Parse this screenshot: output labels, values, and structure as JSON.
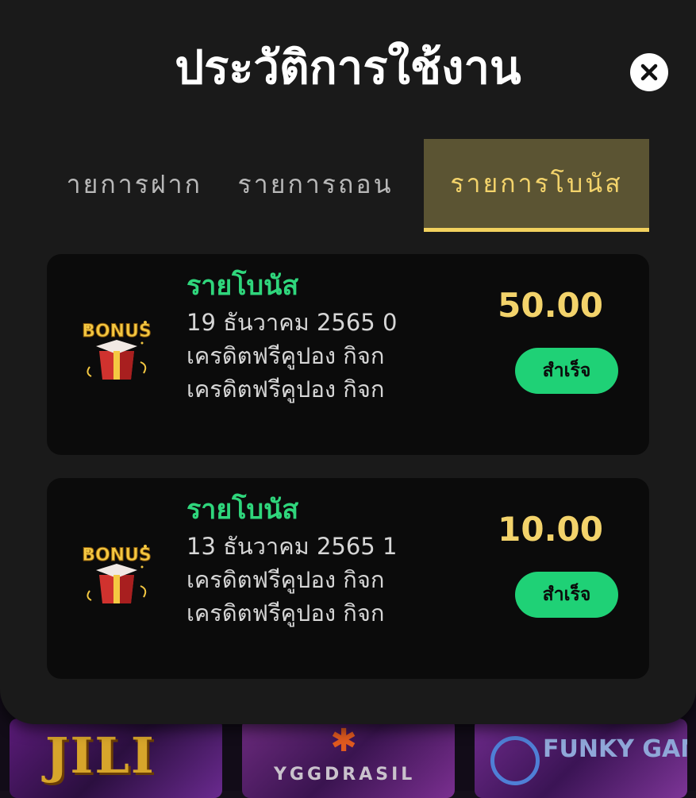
{
  "modal": {
    "title": "ประวัติการใช้งาน",
    "close_icon": "close-icon"
  },
  "tabs": [
    {
      "label": "ายการฝาก",
      "active": false
    },
    {
      "label": "รายการถอน",
      "active": false
    },
    {
      "label": "รายการโบนัส",
      "active": true
    }
  ],
  "entries": [
    {
      "icon": "bonus-gift-icon",
      "title": "รายโบนัส",
      "date": "19 ธันวาคม 2565 0",
      "desc1": "เครดิตฟรีคูปอง กิจก",
      "desc2": "เครดิตฟรีคูปอง กิจก",
      "amount": "50.00",
      "status": "สำเร็จ"
    },
    {
      "icon": "bonus-gift-icon",
      "title": "รายโบนัส",
      "date": "13 ธันวาคม 2565 1",
      "desc1": "เครดิตฟรีคูปอง กิจก",
      "desc2": "เครดิตฟรีคูปอง กิจก",
      "amount": "10.00",
      "status": "สำเร็จ"
    }
  ],
  "background_providers": [
    {
      "label": "JILI"
    },
    {
      "label": "YGGDRASIL"
    },
    {
      "label": "FUNKY GAMES"
    }
  ],
  "colors": {
    "accent_yellow": "#f3d36b",
    "success_green": "#1fd176",
    "modal_bg": "#1a1a1a",
    "card_bg": "#0b0b0b"
  }
}
